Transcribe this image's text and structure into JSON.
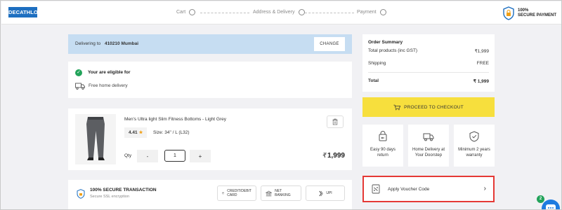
{
  "header": {
    "logo": "DECATHLON",
    "steps": [
      {
        "label": "Cart"
      },
      {
        "label": "Address & Delivery"
      },
      {
        "label": "Payment"
      }
    ],
    "secure_line1": "100%",
    "secure_line2": "SECURE PAYMENT"
  },
  "delivery": {
    "prefix": "Delivering to",
    "location": "410210 Mumbai",
    "change_label": "CHANGE"
  },
  "eligibility": {
    "title": "Your are eligible for",
    "benefit": "Free home delivery"
  },
  "product": {
    "name": "Men's Ultra light Slim Fitness Bottoms - Light Grey",
    "rating": "4.41",
    "size": "Size: 34\" / L (L32)",
    "qty_label": "Qty",
    "qty_value": "1",
    "minus_label": "-",
    "plus_label": "+",
    "currency": "₹",
    "price": "1,999"
  },
  "secure_transaction": {
    "title": "100% SECURE TRANSACTION",
    "subtitle": "Secure SSL encryption",
    "options": [
      {
        "label_line1": "CREDIT/DEBIT",
        "label_line2": "CARD",
        "icon": "card-icon"
      },
      {
        "label_line1": "NET BANKING",
        "label_line2": "",
        "icon": "bank-icon"
      },
      {
        "label_line1": "UPI",
        "label_line2": "",
        "icon": "upi-icon"
      }
    ]
  },
  "summary": {
    "title": "Order Summary",
    "rows": [
      {
        "label": "Total products (inc GST)",
        "value": "₹1,999"
      },
      {
        "label": "Shipping",
        "value": "FREE"
      }
    ],
    "total_label": "Total",
    "total_value": "₹ 1,999"
  },
  "checkout": {
    "label": "PROCEED TO CHECKOUT"
  },
  "features": [
    {
      "line1": "Easy 90 days",
      "line2": "return",
      "icon": "return-icon"
    },
    {
      "line1": "Home Delivery at",
      "line2": "Your Doorstep",
      "icon": "delivery-truck-icon"
    },
    {
      "line1": "Minimum 2 years",
      "line2": "warranty",
      "icon": "warranty-shield-icon"
    }
  ],
  "voucher": {
    "label": "Apply Voucher Code",
    "highlight_color": "#e53935"
  },
  "chat": {
    "badge_count": "2"
  },
  "colors": {
    "brand": "#1e6fc0",
    "checkout": "#f7df3d",
    "delivery_bar": "#c6ddf2",
    "success": "#22a35a"
  }
}
